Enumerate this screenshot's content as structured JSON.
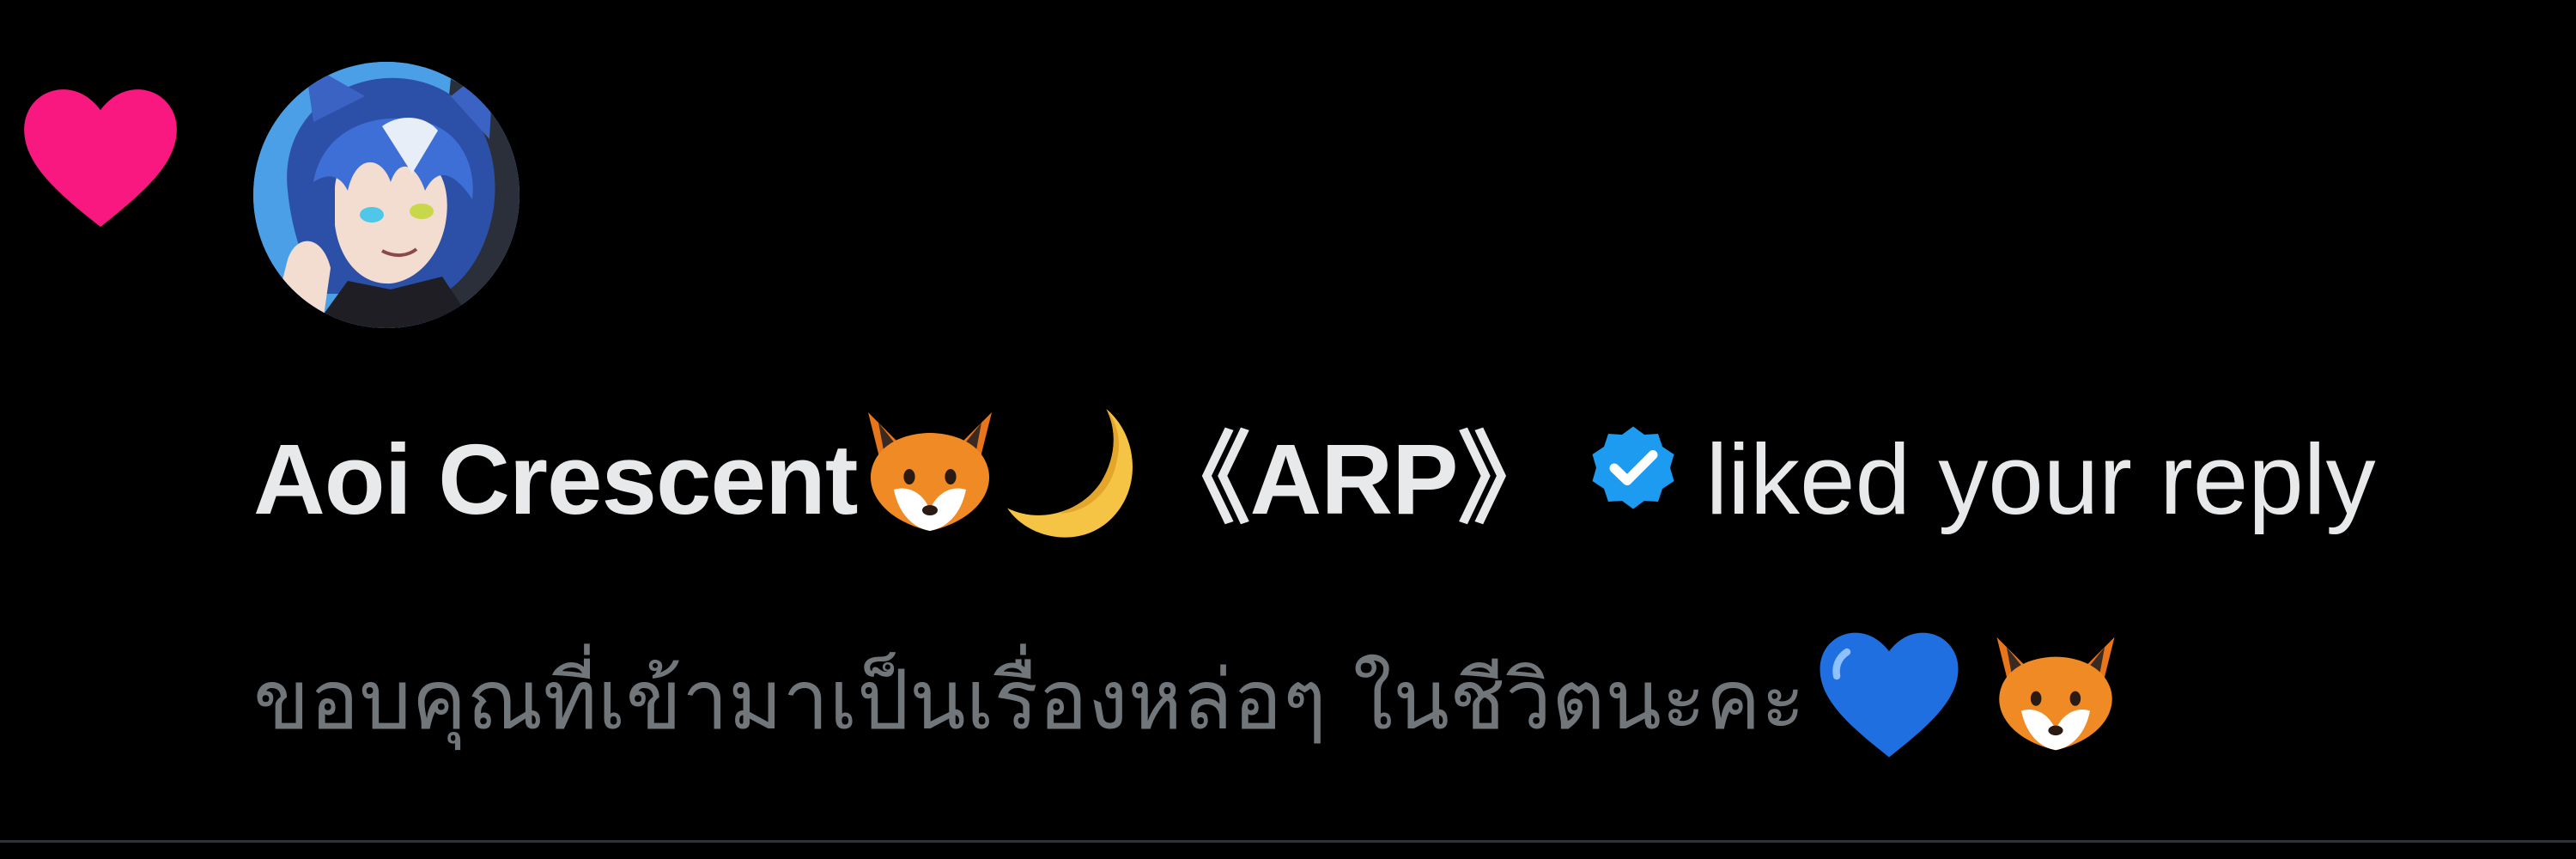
{
  "notification": {
    "type_icon": "heart-icon",
    "avatar": "user-avatar",
    "display_name": "Aoi Crescent",
    "name_emoji_1": "fox-emoji",
    "name_emoji_2": "crescent-moon-emoji",
    "name_tag": "《ARP》",
    "verified_badge": "verified-badge-icon",
    "action_text": "liked your reply",
    "preview_text": "ขอบคุณที่เข้ามาเป็นเรื่องหล่อๆ ในชีวิตนะคะ",
    "preview_emoji_1": "blue-heart-emoji",
    "preview_emoji_2": "fox-emoji"
  },
  "colors": {
    "background": "#000000",
    "heart": "#f91880",
    "primary_text": "#e7e9ea",
    "secondary_text": "#71767b",
    "verified": "#1d9bf0",
    "divider": "#2f3336"
  }
}
